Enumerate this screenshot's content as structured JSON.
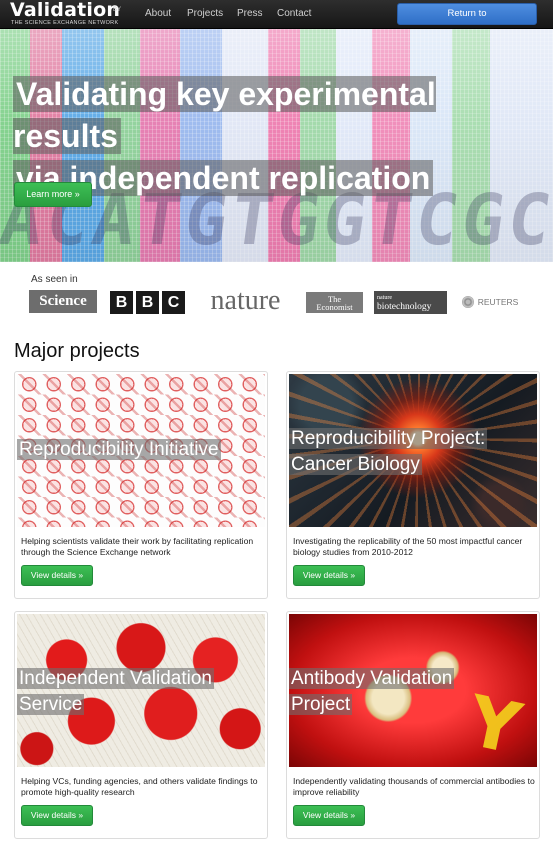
{
  "nav": {
    "brand": "Validation",
    "brand_by": "BY",
    "brand_sub": "THE SCIENCE EXCHANGE NETWORK",
    "links": [
      "About",
      "Projects",
      "Press",
      "Contact"
    ],
    "return_button": "Return to ScienceExchange.com"
  },
  "hero": {
    "title_line1": "Validating key experimental results",
    "title_line2": "via independent replication",
    "background_letters": "ACATGTGGTCGC",
    "cta": "Learn more »"
  },
  "press": {
    "label": "As seen in",
    "logos": {
      "science": "Science",
      "bbc": [
        "B",
        "B",
        "C"
      ],
      "nature": "nature",
      "economist_line1": "The",
      "economist_line2": "Economist",
      "natbio_small": "nature",
      "natbio_main": "biotechnology",
      "reuters": "REUTERS"
    }
  },
  "projects": {
    "heading": "Major projects",
    "items": [
      {
        "title_lines": [
          "Reproducibility Initiative"
        ],
        "description": "Helping scientists validate their work by facilitating replication through the Science Exchange network",
        "button": "View details »"
      },
      {
        "title_lines": [
          "Reproducibility Project:",
          "Cancer Biology"
        ],
        "description": "Investigating the replicability of the 50 most impactful cancer biology studies from 2010-2012",
        "button": "View details »"
      },
      {
        "title_lines": [
          "Independent Validation",
          "Service"
        ],
        "description": "Helping VCs, funding agencies, and others validate findings to promote high-quality research",
        "button": "View details »"
      },
      {
        "title_lines": [
          "Antibody Validation",
          "Project"
        ],
        "description": "Independently validating thousands of commercial antibodies to improve reliability",
        "button": "View details »"
      }
    ]
  },
  "colors": {
    "navbar": "#1f1f1f",
    "primary_button": "#3a7dd8",
    "success_button": "#2ea84a"
  }
}
